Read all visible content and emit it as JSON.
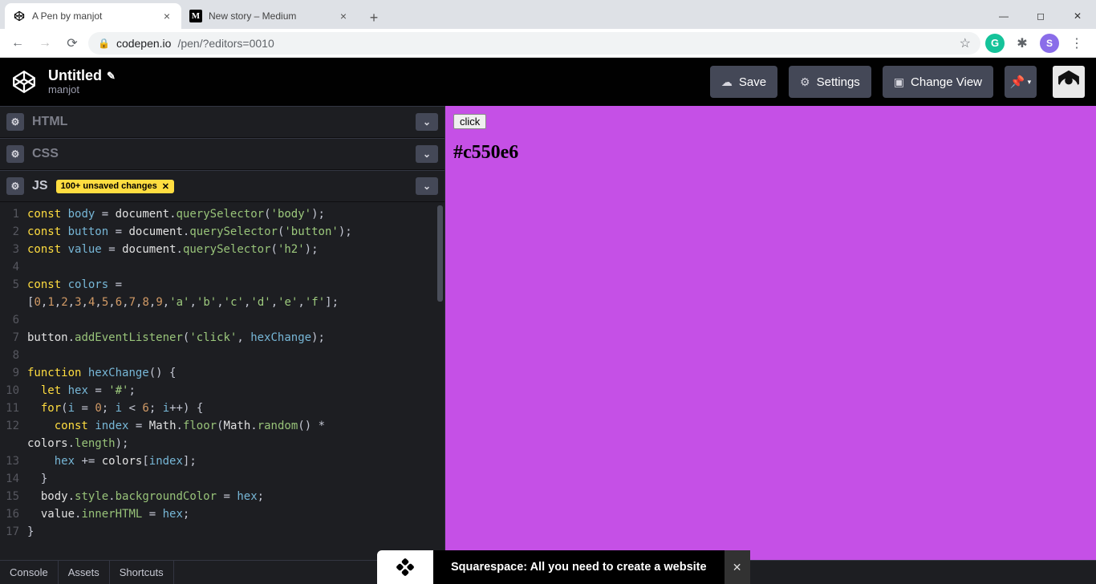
{
  "browser": {
    "tabs": [
      {
        "title": "A Pen by manjot",
        "active": true
      },
      {
        "title": "New story – Medium",
        "active": false
      }
    ],
    "url_host": "codepen.io",
    "url_path": "/pen/?editors=0010"
  },
  "header": {
    "pen_title": "Untitled",
    "author": "manjot",
    "buttons": {
      "save": "Save",
      "settings": "Settings",
      "change_view": "Change View"
    }
  },
  "panels": {
    "html": {
      "label": "HTML"
    },
    "css": {
      "label": "CSS"
    },
    "js": {
      "label": "JS",
      "badge": "100+ unsaved changes"
    }
  },
  "editor": {
    "lines": [
      "const body = document.querySelector('body');",
      "const button = document.querySelector('button');",
      "const value = document.querySelector('h2');",
      "",
      "const colors = ",
      "[0,1,2,3,4,5,6,7,8,9,'a','b','c','d','e','f'];",
      "",
      "button.addEventListener('click', hexChange);",
      "",
      "function hexChange() {",
      "  let hex = '#';",
      "  for(i = 0; i < 6; i++) {",
      "    const index = Math.floor(Math.random() * colors.length);",
      "    hex += colors[index];",
      "  }",
      "  body.style.backgroundColor = hex;",
      "  value.innerHTML = hex;",
      "}"
    ]
  },
  "preview": {
    "button_label": "click",
    "hex_value": "#c550e6",
    "bg": "#c550e6"
  },
  "footer": {
    "console": "Console",
    "assets": "Assets",
    "shortcuts": "Shortcuts"
  },
  "ad": {
    "text": "Squarespace: All you need to create a website"
  }
}
